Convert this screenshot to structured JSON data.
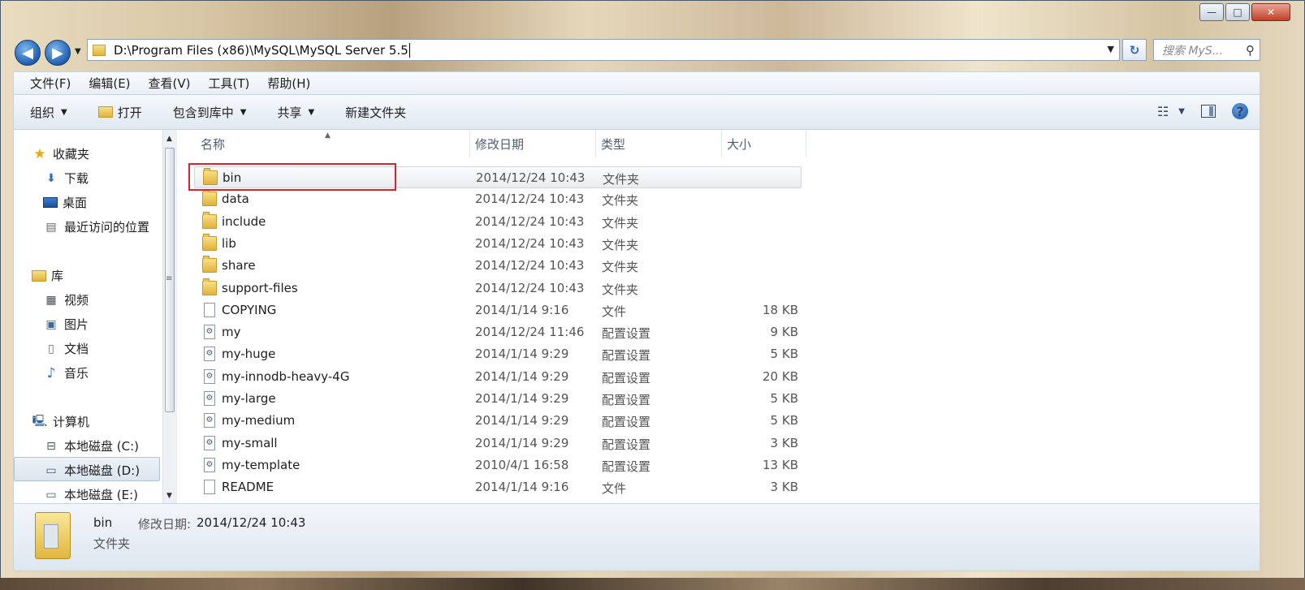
{
  "window": {
    "minimize": "—",
    "maximize": "□",
    "close": "✕"
  },
  "nav": {
    "back": "◀",
    "forward": "▶",
    "address": "D:\\Program Files (x86)\\MySQL\\MySQL Server 5.5",
    "search_placeholder": "搜索 MyS..."
  },
  "menubar": [
    "文件(F)",
    "编辑(E)",
    "查看(V)",
    "工具(T)",
    "帮助(H)"
  ],
  "toolbar": {
    "organize": "组织",
    "open": "打开",
    "include_library": "包含到库中",
    "share": "共享",
    "new_folder": "新建文件夹"
  },
  "sidebar": {
    "favorites": "收藏夹",
    "downloads": "下载",
    "desktop": "桌面",
    "recent": "最近访问的位置",
    "libraries": "库",
    "videos": "视频",
    "pictures": "图片",
    "documents": "文档",
    "music": "音乐",
    "computer": "计算机",
    "drive_c": "本地磁盘 (C:)",
    "drive_d": "本地磁盘 (D:)",
    "drive_e": "本地磁盘 (E:)"
  },
  "columns": {
    "name": "名称",
    "date": "修改日期",
    "type": "类型",
    "size": "大小"
  },
  "files": [
    {
      "name": "bin",
      "date": "2014/12/24 10:43",
      "type": "文件夹",
      "size": "",
      "icon": "folder-icon"
    },
    {
      "name": "data",
      "date": "2014/12/24 10:43",
      "type": "文件夹",
      "size": "",
      "icon": "folder-icon"
    },
    {
      "name": "include",
      "date": "2014/12/24 10:43",
      "type": "文件夹",
      "size": "",
      "icon": "folder-icon"
    },
    {
      "name": "lib",
      "date": "2014/12/24 10:43",
      "type": "文件夹",
      "size": "",
      "icon": "folder-icon"
    },
    {
      "name": "share",
      "date": "2014/12/24 10:43",
      "type": "文件夹",
      "size": "",
      "icon": "folder-icon"
    },
    {
      "name": "support-files",
      "date": "2014/12/24 10:43",
      "type": "文件夹",
      "size": "",
      "icon": "folder-icon"
    },
    {
      "name": "COPYING",
      "date": "2014/1/14 9:16",
      "type": "文件",
      "size": "18 KB",
      "icon": "file-icon"
    },
    {
      "name": "my",
      "date": "2014/12/24 11:46",
      "type": "配置设置",
      "size": "9 KB",
      "icon": "config-file-icon"
    },
    {
      "name": "my-huge",
      "date": "2014/1/14 9:29",
      "type": "配置设置",
      "size": "5 KB",
      "icon": "config-file-icon"
    },
    {
      "name": "my-innodb-heavy-4G",
      "date": "2014/1/14 9:29",
      "type": "配置设置",
      "size": "20 KB",
      "icon": "config-file-icon"
    },
    {
      "name": "my-large",
      "date": "2014/1/14 9:29",
      "type": "配置设置",
      "size": "5 KB",
      "icon": "config-file-icon"
    },
    {
      "name": "my-medium",
      "date": "2014/1/14 9:29",
      "type": "配置设置",
      "size": "5 KB",
      "icon": "config-file-icon"
    },
    {
      "name": "my-small",
      "date": "2014/1/14 9:29",
      "type": "配置设置",
      "size": "3 KB",
      "icon": "config-file-icon"
    },
    {
      "name": "my-template",
      "date": "2010/4/1 16:58",
      "type": "配置设置",
      "size": "13 KB",
      "icon": "config-file-icon"
    },
    {
      "name": "README",
      "date": "2014/1/14 9:16",
      "type": "文件",
      "size": "3 KB",
      "icon": "file-icon"
    }
  ],
  "details": {
    "name": "bin",
    "date_label": "修改日期:",
    "date": "2014/12/24 10:43",
    "type": "文件夹"
  },
  "colors": {
    "highlight_box": "#e0202a",
    "nav_button": "#1f5fb2"
  }
}
